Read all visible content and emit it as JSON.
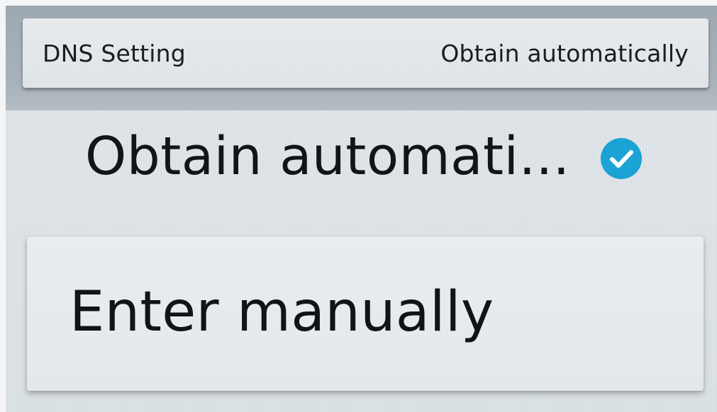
{
  "header": {
    "title": "DNS Setting",
    "value": "Obtain automatically"
  },
  "options": [
    {
      "label": "Obtain automati...",
      "selected": true,
      "icon": "checkmark-circle-icon"
    },
    {
      "label": "Enter manually",
      "selected": false,
      "focused": true
    }
  ],
  "colors": {
    "check_accent": "#1aa3d4",
    "header_band": "#a4aeb5",
    "focus_card": "#e7ebee"
  }
}
